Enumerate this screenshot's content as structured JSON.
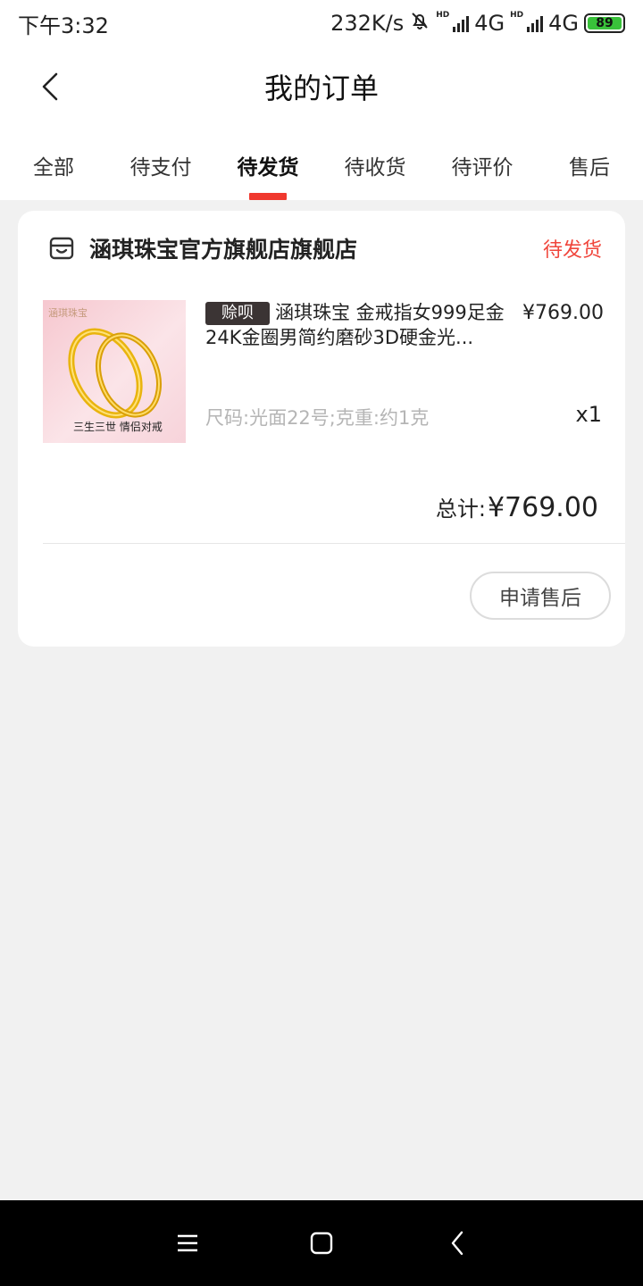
{
  "status_bar": {
    "time": "下午3:32",
    "speed": "232K/s",
    "net1": "4G",
    "net2": "4G",
    "hd_label": "HD",
    "battery": "89",
    "icons": [
      "mute-bell-icon",
      "signal-icon",
      "battery-icon"
    ]
  },
  "nav": {
    "title": "我的订单",
    "back_icon": "chevron-left-icon"
  },
  "tabs": [
    {
      "label": "全部"
    },
    {
      "label": "待支付"
    },
    {
      "label": "待发货"
    },
    {
      "label": "待收货"
    },
    {
      "label": "待评价"
    },
    {
      "label": "售后"
    }
  ],
  "active_tab": "待发货",
  "order": {
    "shop_name": "涵琪珠宝官方旗舰店旗舰店",
    "shop_icon": "store-icon",
    "status": "待发货",
    "product": {
      "badge": "赊呗",
      "title": "涵琪珠宝 金戒指女999足金24K金圈男简约磨砂3D硬金光...",
      "price": "¥769.00",
      "spec": "尺码:光面22号;克重:约1克",
      "quantity": "x1",
      "image_brand": "涵琪珠宝",
      "image_caption": "三生三世 情侣对戒"
    },
    "total_label": "总计:",
    "total_value": "¥769.00",
    "action_button": "申请售后"
  },
  "colors": {
    "accent": "#f0382e",
    "status_text": "#f0463c",
    "badge_bg": "#3b3434",
    "page_bg": "#f1f1f1",
    "battery": "#39c23a"
  },
  "system_nav": [
    "menu-icon",
    "home-icon",
    "back-icon"
  ]
}
